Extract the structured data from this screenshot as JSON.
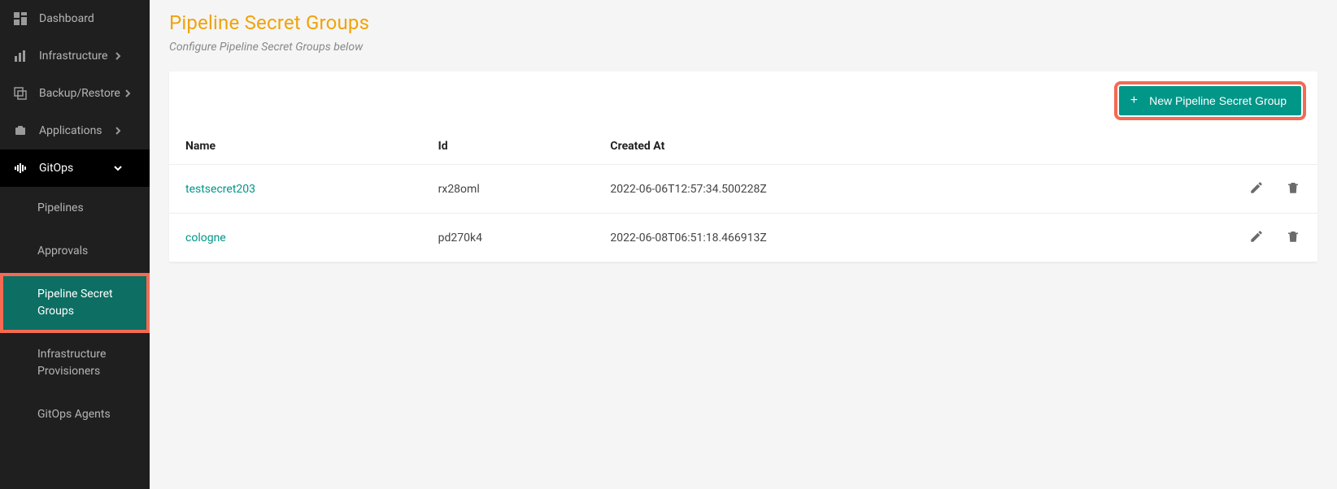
{
  "sidebar": {
    "items": [
      {
        "label": "Dashboard",
        "icon": "dashboard",
        "expandable": false
      },
      {
        "label": "Infrastructure",
        "icon": "infrastructure",
        "expandable": true
      },
      {
        "label": "Backup/Restore",
        "icon": "backup",
        "expandable": true
      },
      {
        "label": "Applications",
        "icon": "applications",
        "expandable": true
      },
      {
        "label": "GitOps",
        "icon": "gitops",
        "expandable": true,
        "active": true
      }
    ],
    "gitops_children": [
      {
        "label": "Pipelines"
      },
      {
        "label": "Approvals"
      },
      {
        "label": "Pipeline Secret Groups",
        "active": true
      },
      {
        "label": "Infrastructure Provisioners"
      },
      {
        "label": "GitOps Agents"
      }
    ]
  },
  "page": {
    "title": "Pipeline Secret Groups",
    "subtitle": "Configure Pipeline Secret Groups below",
    "new_button": "New Pipeline Secret Group"
  },
  "table": {
    "columns": {
      "name": "Name",
      "id": "Id",
      "created": "Created At"
    },
    "rows": [
      {
        "name": "testsecret203",
        "id": "rx28oml",
        "created": "2022-06-06T12:57:34.500228Z"
      },
      {
        "name": "cologne",
        "id": "pd270k4",
        "created": "2022-06-08T06:51:18.466913Z"
      }
    ]
  }
}
